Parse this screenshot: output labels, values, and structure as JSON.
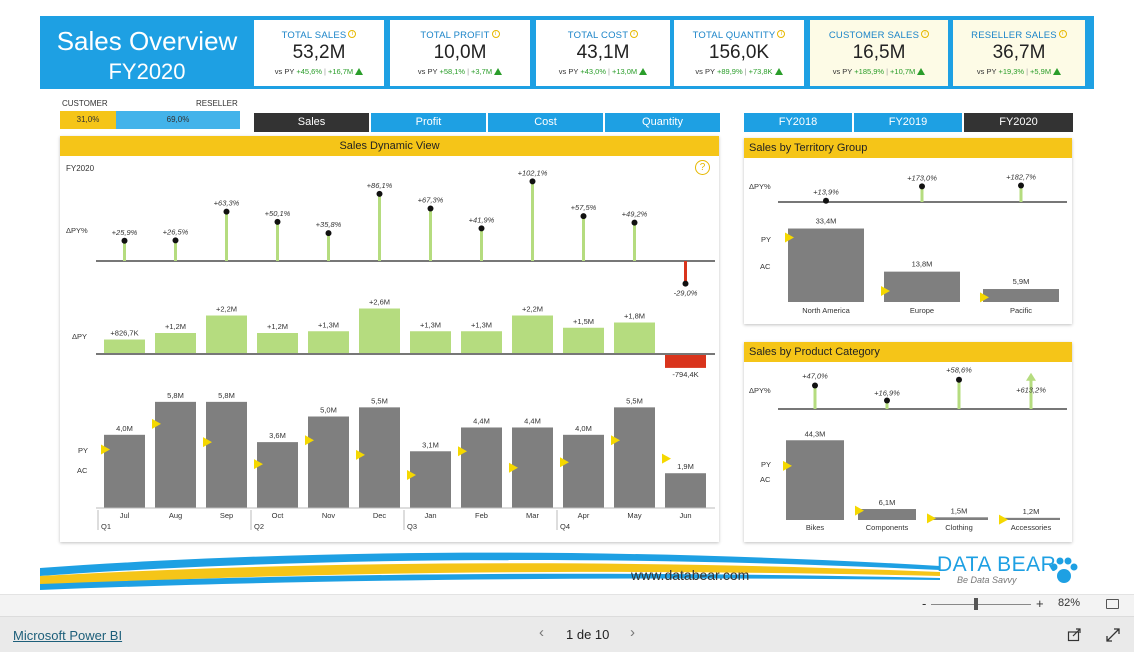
{
  "header": {
    "title": "Sales Overview",
    "subtitle": "FY2020",
    "info_glyph": "i",
    "kpis": [
      {
        "title": "TOTAL SALES",
        "value": "53,2M",
        "vs": "vs PY",
        "pct": "+45,6%",
        "abs": "+16,7M"
      },
      {
        "title": "TOTAL PROFIT",
        "value": "10,0M",
        "vs": "vs PY",
        "pct": "+58,1%",
        "abs": "+3,7M"
      },
      {
        "title": "TOTAL COST",
        "value": "43,1M",
        "vs": "vs PY",
        "pct": "+43,0%",
        "abs": "+13,0M"
      },
      {
        "title": "TOTAL QUANTITY",
        "value": "156,0K",
        "vs": "vs PY",
        "pct": "+89,9%",
        "abs": "+73,8K"
      },
      {
        "title": "CUSTOMER SALES",
        "value": "16,5M",
        "vs": "vs PY",
        "pct": "+185,9%",
        "abs": "+10,7M"
      },
      {
        "title": "RESELLER SALES",
        "value": "36,7M",
        "vs": "vs PY",
        "pct": "+19,3%",
        "abs": "+5,9M"
      }
    ]
  },
  "split": {
    "customer_label": "CUSTOMER",
    "reseller_label": "RESELLER",
    "customer_pct": "31,0%",
    "reseller_pct": "69,0%",
    "customer_share": 0.31
  },
  "measure_tabs": [
    "Sales",
    "Profit",
    "Cost",
    "Quantity"
  ],
  "active_measure": "Sales",
  "year_tabs": [
    "FY2018",
    "FY2019",
    "FY2020"
  ],
  "active_year": "FY2020",
  "dynamic": {
    "title": "Sales Dynamic View",
    "year_label": "FY2020",
    "help_icon": "?",
    "dpy_pct_label": "ΔPY%",
    "dpy_label": "ΔPY",
    "py_label": "PY",
    "ac_label": "AC",
    "quarters": [
      "Q1",
      "Q2",
      "Q3",
      "Q4"
    ]
  },
  "territory": {
    "title": "Sales by Territory Group",
    "dpy_pct_label": "ΔPY%",
    "py_label": "PY",
    "ac_label": "AC"
  },
  "category": {
    "title": "Sales by Product Category",
    "dpy_pct_label": "ΔPY%",
    "py_label": "PY",
    "ac_label": "AC"
  },
  "chart_data": [
    {
      "type": "bar",
      "name": "sales-dynamic-view",
      "categories": [
        "Jul",
        "Aug",
        "Sep",
        "Oct",
        "Nov",
        "Dec",
        "Jan",
        "Feb",
        "Mar",
        "Apr",
        "May",
        "Jun"
      ],
      "ac_values": [
        4.0,
        5.8,
        5.8,
        3.6,
        5.0,
        5.5,
        3.1,
        4.4,
        4.4,
        4.0,
        5.5,
        1.9
      ],
      "ac_labels": [
        "4,0M",
        "5,8M",
        "5,8M",
        "3,6M",
        "5,0M",
        "5,5M",
        "3,1M",
        "4,4M",
        "4,4M",
        "4,0M",
        "5,5M",
        "1,9M"
      ],
      "py_values": [
        3.2,
        4.6,
        3.6,
        2.4,
        3.7,
        2.9,
        1.8,
        3.1,
        2.2,
        2.5,
        3.7,
        2.7
      ],
      "delta_py_values": [
        0.8267,
        1.2,
        2.2,
        1.2,
        1.3,
        2.6,
        1.3,
        1.3,
        2.2,
        1.5,
        1.8,
        -0.7944
      ],
      "delta_py_labels": [
        "+826,7K",
        "+1,2M",
        "+2,2M",
        "+1,2M",
        "+1,3M",
        "+2,6M",
        "+1,3M",
        "+1,3M",
        "+2,2M",
        "+1,5M",
        "+1,8M",
        "-794,4K"
      ],
      "delta_pct_values": [
        25.9,
        26.5,
        63.3,
        50.1,
        35.8,
        86.1,
        67.3,
        41.9,
        102.1,
        57.5,
        49.2,
        -29.0
      ],
      "delta_pct_labels": [
        "+25,9%",
        "+26,5%",
        "+63,3%",
        "+50,1%",
        "+35,8%",
        "+86,1%",
        "+67,3%",
        "+41,9%",
        "+102,1%",
        "+57,5%",
        "+49,2%",
        "-29,0%"
      ]
    },
    {
      "type": "bar",
      "name": "sales-by-territory-group",
      "categories": [
        "North America",
        "Europe",
        "Pacific"
      ],
      "ac_values": [
        33.4,
        13.8,
        5.9
      ],
      "ac_labels": [
        "33,4M",
        "13,8M",
        "5,9M"
      ],
      "py_values": [
        29.3,
        5.0,
        2.1
      ],
      "delta_pct_values": [
        13.9,
        173.0,
        182.7
      ],
      "delta_pct_labels": [
        "+13,9%",
        "+173,0%",
        "+182,7%"
      ]
    },
    {
      "type": "bar",
      "name": "sales-by-product-category",
      "categories": [
        "Bikes",
        "Components",
        "Clothing",
        "Accessories"
      ],
      "ac_values": [
        44.3,
        6.1,
        1.5,
        1.2
      ],
      "ac_labels": [
        "44,3M",
        "6,1M",
        "1,5M",
        "1,2M"
      ],
      "py_values": [
        30.1,
        5.2,
        0.9,
        0.2
      ],
      "delta_pct_values": [
        47.0,
        16.9,
        58.6,
        613.2
      ],
      "delta_pct_labels": [
        "+47,0%",
        "+16,9%",
        "+58,6%",
        "+613,2%"
      ]
    }
  ],
  "footer": {
    "website": "www.databear.com",
    "logo": "DATA BEAR",
    "tagline": "Be Data Savvy",
    "zoom_minus": "-",
    "zoom_plus": "+",
    "zoom_level": "82%",
    "zoom_fraction": 0.45,
    "powerbi_link": "Microsoft Power BI",
    "pager": "1 de 10",
    "prev": "‹",
    "next": "›"
  },
  "colors": {
    "brand_blue": "#1ea0e3",
    "accent_yellow": "#f5c518",
    "positive": "#b5dc7f",
    "negative": "#d9341c",
    "ac_bar": "#7f7f7f",
    "dark_tab": "#333333"
  }
}
